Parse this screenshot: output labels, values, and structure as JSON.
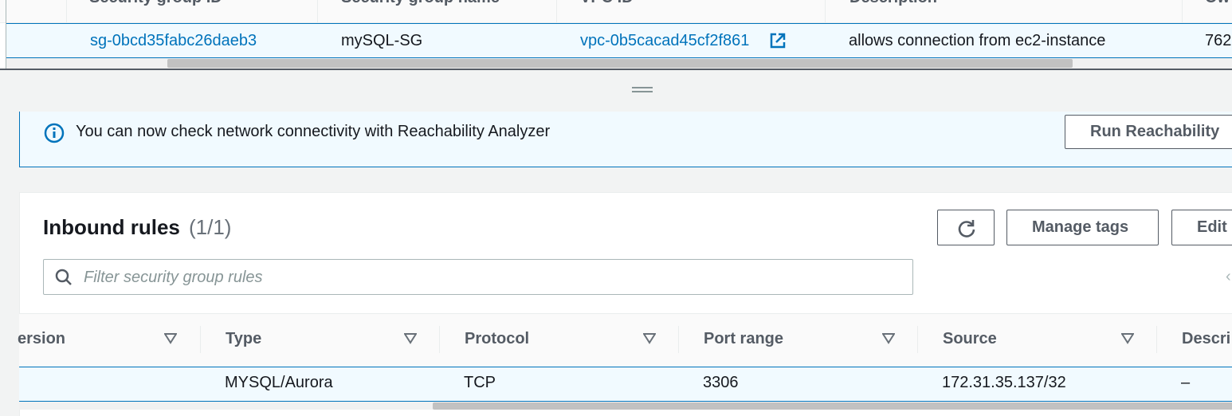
{
  "sg_table": {
    "columns": [
      {
        "label": "Security group ID"
      },
      {
        "label": "Security group name"
      },
      {
        "label": "VPC ID"
      },
      {
        "label": "Description"
      },
      {
        "label": "Ow"
      }
    ],
    "row": {
      "sg_id": "sg-0bcd35fabc26daeb3",
      "name": "mySQL-SG",
      "vpc_id": "vpc-0b5cacad45cf2f861",
      "description": "allows connection from ec2-instance",
      "owner": "762"
    }
  },
  "banner": {
    "icon": "info-icon",
    "text": "You can now check network connectivity with Reachability Analyzer",
    "button_label": "Run Reachability"
  },
  "inbound": {
    "title": "Inbound rules",
    "count": "(1/1)",
    "refresh_icon": "refresh-icon",
    "manage_tags_label": "Manage tags",
    "edit_label": "Edit",
    "filter_placeholder": "Filter security group rules",
    "columns": [
      {
        "label": "ersion"
      },
      {
        "label": "Type"
      },
      {
        "label": "Protocol"
      },
      {
        "label": "Port range"
      },
      {
        "label": "Source"
      },
      {
        "label": "Descri"
      }
    ],
    "rows": [
      {
        "type": "MYSQL/Aurora",
        "protocol": "TCP",
        "port_range": "3306",
        "source": "172.31.35.137/32",
        "description": "–"
      }
    ]
  },
  "colors": {
    "link": "#0073bb",
    "selected_row_bg": "#f1faff",
    "page_bg": "#f2f3f3"
  }
}
